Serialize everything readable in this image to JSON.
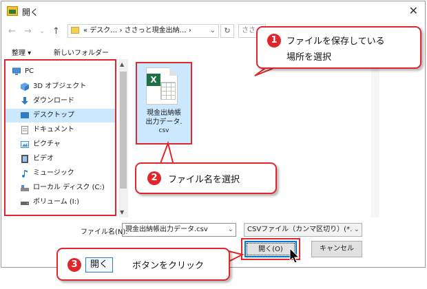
{
  "window": {
    "title": "開く",
    "close_glyph": "✕"
  },
  "nav": {
    "back": "←",
    "forward": "→",
    "dropdown": "⌄",
    "up": "↑",
    "address": "«  デスク…  ›  ささっと現金出納…  ›",
    "address_dropdown": "⌄",
    "refresh": "↻",
    "search_placeholder": "ささっ"
  },
  "toolbar": {
    "organize": "整理 ▾",
    "new_folder": "新しいフォルダー"
  },
  "sidebar": {
    "items": [
      {
        "label": "PC",
        "icon": "computer-icon"
      },
      {
        "label": "3D オブジェクト",
        "icon": "cube-icon"
      },
      {
        "label": "ダウンロード",
        "icon": "download-icon"
      },
      {
        "label": "デスクトップ",
        "icon": "desktop-icon",
        "selected": true
      },
      {
        "label": "ドキュメント",
        "icon": "document-icon"
      },
      {
        "label": "ピクチャ",
        "icon": "pictures-icon"
      },
      {
        "label": "ビデオ",
        "icon": "video-icon"
      },
      {
        "label": "ミュージック",
        "icon": "music-icon"
      },
      {
        "label": "ローカル ディスク (C:)",
        "icon": "disk-icon"
      },
      {
        "label": "ボリューム (I:)",
        "icon": "drive-icon"
      }
    ]
  },
  "file": {
    "name_line1": "現金出納帳",
    "name_line2": "出力データ.",
    "name_line3": "csv",
    "badge": "X"
  },
  "bottom": {
    "filename_label": "ファイル名(N):",
    "filename_value": "現金出納帳出力データ.csv",
    "filename_dropdown": "⌄",
    "filetype_value": "CSVファイル（カンマ区切り）(*.cs",
    "filetype_dropdown": "⌄",
    "open_button": "開く(O)",
    "cancel_button": "キャンセル"
  },
  "callouts": {
    "c1": {
      "number": "1",
      "line1": "ファイルを保存している",
      "line2": "場所を選択"
    },
    "c2": {
      "number": "2",
      "text": "ファイル名を選択"
    },
    "c3": {
      "number": "3",
      "chip": "開く",
      "text": "ボタンをクリック"
    }
  },
  "colors": {
    "accent_red": "#e0262b",
    "select_blue": "#cce8ff",
    "excel_green": "#1e7145"
  }
}
